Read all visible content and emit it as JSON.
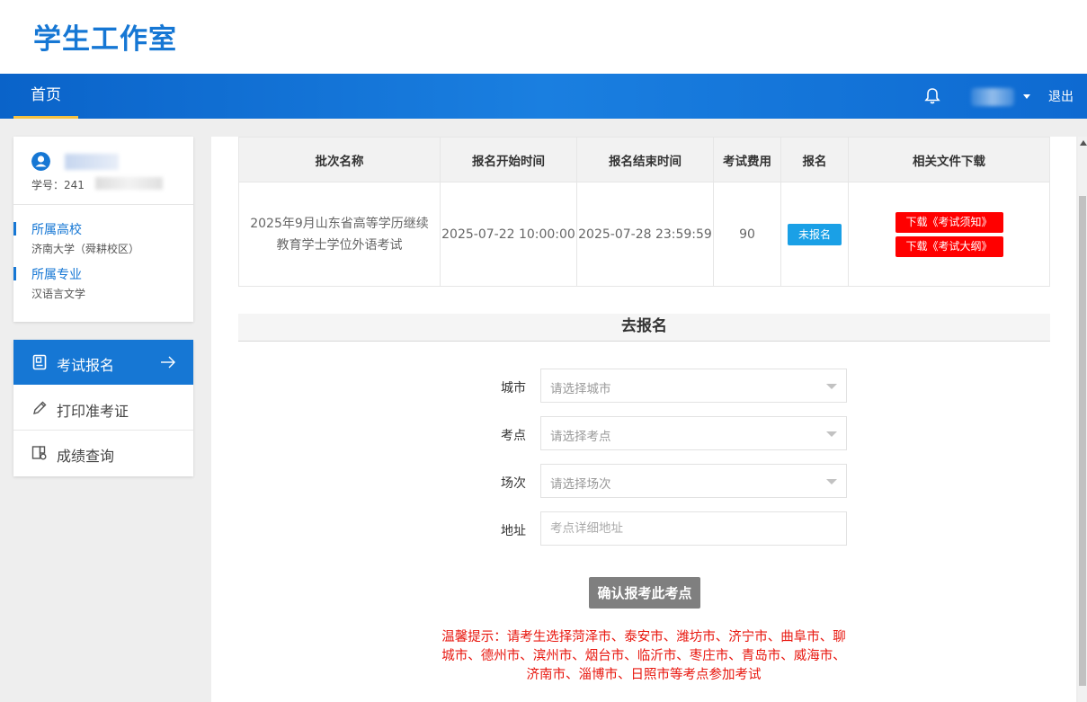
{
  "header": {
    "logo": "学生工作室"
  },
  "nav": {
    "home": "首页",
    "logout": "退出"
  },
  "profile": {
    "student_no_label": "学号：241",
    "school_label": "所属高校",
    "school_value": "济南大学（舜耕校区）",
    "major_label": "所属专业",
    "major_value": "汉语言文学"
  },
  "menu": [
    {
      "label": "考试报名",
      "icon": "exam-register-icon",
      "active": true
    },
    {
      "label": "打印准考证",
      "icon": "pencil-icon",
      "active": false
    },
    {
      "label": "成绩查询",
      "icon": "score-query-icon",
      "active": false
    }
  ],
  "table": {
    "headers": [
      "批次名称",
      "报名开始时间",
      "报名结束时间",
      "考试费用",
      "报名",
      "相关文件下载"
    ],
    "row": {
      "name": "2025年9月山东省高等学历继续教育学士学位外语考试",
      "start": "2025-07-22 10:00:00",
      "end": "2025-07-28 23:59:59",
      "fee": "90",
      "status": "未报名",
      "downloads": [
        "下载《考试须知》",
        "下载《考试大纲》"
      ]
    }
  },
  "form": {
    "section_title": "去报名",
    "city_label": "城市",
    "city_placeholder": "请选择城市",
    "site_label": "考点",
    "site_placeholder": "请选择考点",
    "session_label": "场次",
    "session_placeholder": "请选择场次",
    "address_label": "地址",
    "address_placeholder": "考点详细地址",
    "confirm": "确认报考此考点",
    "tip": "温馨提示：请考生选择菏泽市、泰安市、潍坊市、济宁市、曲阜市、聊城市、德州市、滨州市、烟台市、临沂市、枣庄市、青岛市、威海市、济南市、淄博市、日照市等考点参加考试"
  },
  "colors": {
    "primary": "#1677d4",
    "download": "#ff0000",
    "tip": "#e8170f",
    "badge": "#1aa0e6"
  }
}
